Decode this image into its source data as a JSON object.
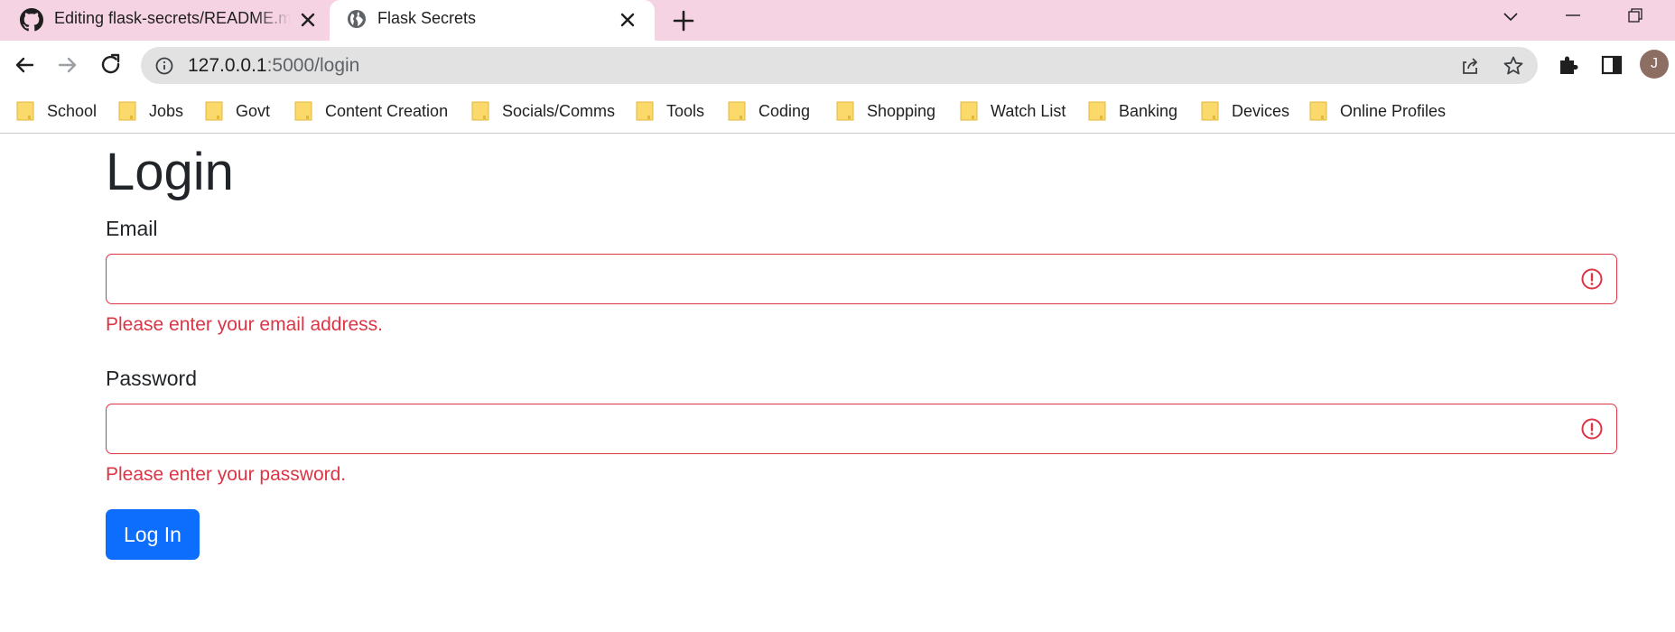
{
  "browser": {
    "tabs": [
      {
        "title": "Editing flask-secrets/README.md",
        "favicon": "github-icon",
        "active": false
      },
      {
        "title": "Flask Secrets",
        "favicon": "globe-icon",
        "active": true
      }
    ],
    "omnibox": {
      "url_host": "127.0.0.1",
      "url_rest": ":5000/login"
    },
    "profile_initial": "J",
    "bookmarks": [
      "School",
      "Jobs",
      "Govt",
      "Content Creation",
      "Socials/Comms",
      "Tools",
      "Coding",
      "Shopping",
      "Watch List",
      "Banking",
      "Devices",
      "Online Profiles"
    ]
  },
  "page": {
    "title": "Login",
    "email": {
      "label": "Email",
      "value": "",
      "error": "Please enter your email address."
    },
    "password": {
      "label": "Password",
      "value": "",
      "error": "Please enter your password."
    },
    "submit_label": "Log In"
  },
  "colors": {
    "tabstrip": "#f6d3e3",
    "error": "#dc3545",
    "primary": "#0d6efd",
    "avatar": "#8d6e63",
    "folder": "#fbd96b"
  }
}
